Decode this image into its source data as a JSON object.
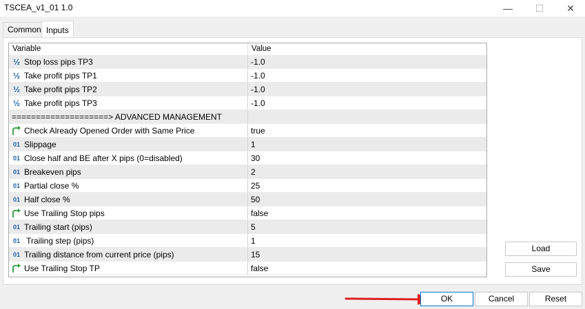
{
  "window": {
    "title": "TSCEA_v1_01 1.0",
    "minimize": "—",
    "maximize": "☐",
    "close": "✕"
  },
  "tabs": [
    {
      "label": "Common"
    },
    {
      "label": "Inputs"
    }
  ],
  "grid": {
    "headers": {
      "variable": "Variable",
      "value": "Value"
    },
    "rows": [
      {
        "icon": "half",
        "name": "Stop loss pips TP3",
        "value": "-1.0"
      },
      {
        "icon": "half",
        "name": "Take profit pips TP1",
        "value": "-1.0"
      },
      {
        "icon": "half",
        "name": "Take profit pips TP2",
        "value": "-1.0"
      },
      {
        "icon": "half",
        "name": "Take profit pips TP3",
        "value": "-1.0"
      },
      {
        "icon": "none",
        "name": "====================> ADVANCED MANAGEMENT",
        "value": ""
      },
      {
        "icon": "bool",
        "name": "Check Already Opened Order with Same Price",
        "value": "true"
      },
      {
        "icon": "int",
        "name": "Slippage",
        "value": "1"
      },
      {
        "icon": "int",
        "name": "Close half and BE after X pips (0=disabled)",
        "value": "30"
      },
      {
        "icon": "int",
        "name": "Breakeven pips",
        "value": "2"
      },
      {
        "icon": "int",
        "name": "Partial close %",
        "value": "25"
      },
      {
        "icon": "int",
        "name": "Half close %",
        "value": "50"
      },
      {
        "icon": "bool",
        "name": "Use Trailing Stop pips",
        "value": "false"
      },
      {
        "icon": "int",
        "name": "Trailing start (pips)",
        "value": "5"
      },
      {
        "icon": "int",
        "name": " Trailing step (pips)",
        "value": "1"
      },
      {
        "icon": "int",
        "name": "Trailing distance from current price (pips)",
        "value": "15"
      },
      {
        "icon": "bool",
        "name": "Use Trailing Stop TP",
        "value": "false"
      }
    ],
    "icon_glyphs": {
      "half": "½",
      "int": "01"
    },
    "colors": {
      "icon_blue": "#1f5fa8",
      "icon_green": "#2e9b3a"
    }
  },
  "buttons": {
    "load": "Load",
    "save": "Save",
    "ok": "OK",
    "cancel": "Cancel",
    "reset": "Reset"
  },
  "annotation": {
    "color": "#e02020"
  }
}
